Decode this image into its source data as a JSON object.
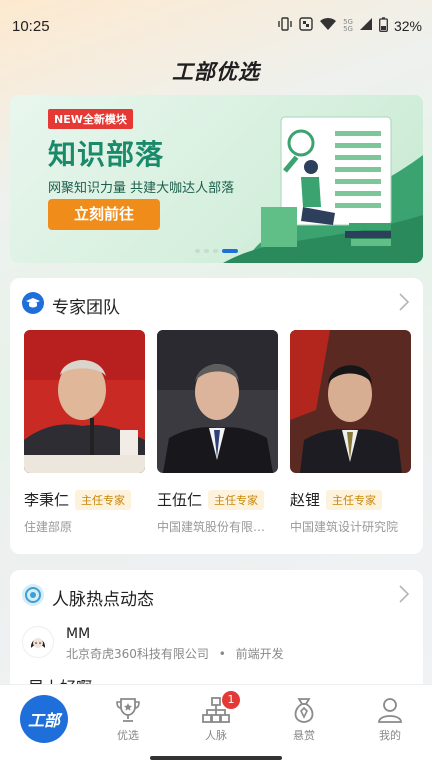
{
  "status": {
    "time": "10:25",
    "battery": "32%",
    "sim1": "5G",
    "sim2": "5G"
  },
  "header": {
    "title": "工部优选"
  },
  "banner": {
    "badge": "NEW全新模块",
    "headline": "知识部落",
    "subtitle": "网聚知识力量 共建大咖达人部落",
    "button_label": "立刻前往",
    "slides": 4,
    "active_slide": 3
  },
  "experts": {
    "title": "专家团队",
    "items": [
      {
        "name": "李秉仁",
        "tag": "主任专家",
        "org": "住建部原"
      },
      {
        "name": "王伍仁",
        "tag": "主任专家",
        "org": "中国建筑股份有限…"
      },
      {
        "name": "赵锂",
        "tag": "主任专家",
        "org": "中国建筑设计研究院"
      }
    ]
  },
  "feed": {
    "title": "人脉热点动态",
    "item": {
      "name": "MM",
      "company": "北京奇虎360科技有限公司",
      "separator": "•",
      "role": "前端开发",
      "text": "早上好啊"
    }
  },
  "tabbar": {
    "home_label": "工部",
    "items": [
      {
        "label": "优选"
      },
      {
        "label": "人脉",
        "badge": "1"
      },
      {
        "label": "悬赏"
      },
      {
        "label": "我的"
      }
    ]
  },
  "colors": {
    "primary": "#1e6fd9",
    "accent_orange": "#f08c1a",
    "badge_red": "#e53935",
    "banner_green": "#1b8a6b"
  }
}
